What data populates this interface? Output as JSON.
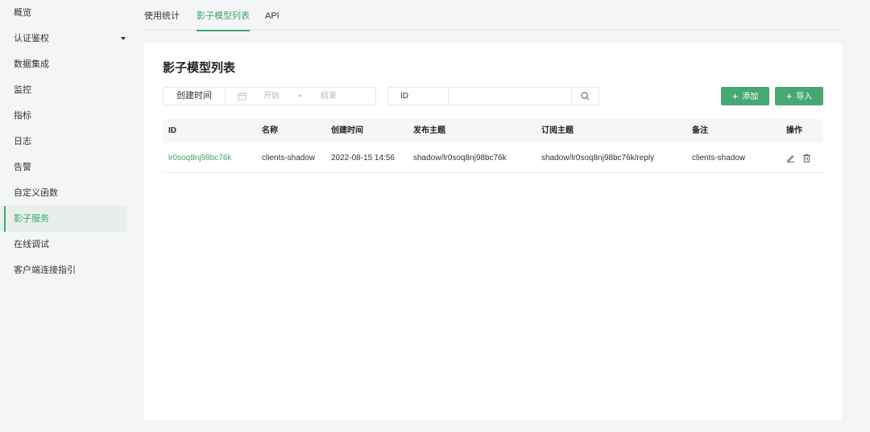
{
  "sidebar": {
    "items": [
      {
        "label": "概览"
      },
      {
        "label": "认证鉴权"
      },
      {
        "label": "数据集成"
      },
      {
        "label": "监控"
      },
      {
        "label": "指标"
      },
      {
        "label": "日志"
      },
      {
        "label": "告警"
      },
      {
        "label": "自定义函数"
      },
      {
        "label": "影子服务"
      },
      {
        "label": "在线调试"
      },
      {
        "label": "客户端连接指引"
      }
    ],
    "active_index": 8
  },
  "tabs": [
    {
      "label": "使用统计"
    },
    {
      "label": "影子模型列表"
    },
    {
      "label": "API"
    }
  ],
  "page": {
    "title": "影子模型列表"
  },
  "filters": {
    "date_label": "创建时间",
    "start_placeholder": "开始",
    "separator": "-",
    "end_placeholder": "结束",
    "search_label": "ID",
    "search_value": ""
  },
  "actions": {
    "add_label": "添加",
    "import_label": "导入"
  },
  "colors": {
    "accent": "#3da66a",
    "button": "#48a872"
  },
  "table": {
    "columns": [
      "ID",
      "名称",
      "创建时间",
      "发布主题",
      "订阅主题",
      "备注",
      "操作"
    ],
    "rows": [
      {
        "id": "lr0soq8nj98bc76k",
        "name": "clients-shadow",
        "created": "2022-08-15 14:56",
        "pub_topic": "shadow/lr0soq8nj98bc76k",
        "sub_topic": "shadow/lr0soq8nj98bc76k/reply",
        "note": "clients-shadow"
      }
    ]
  }
}
